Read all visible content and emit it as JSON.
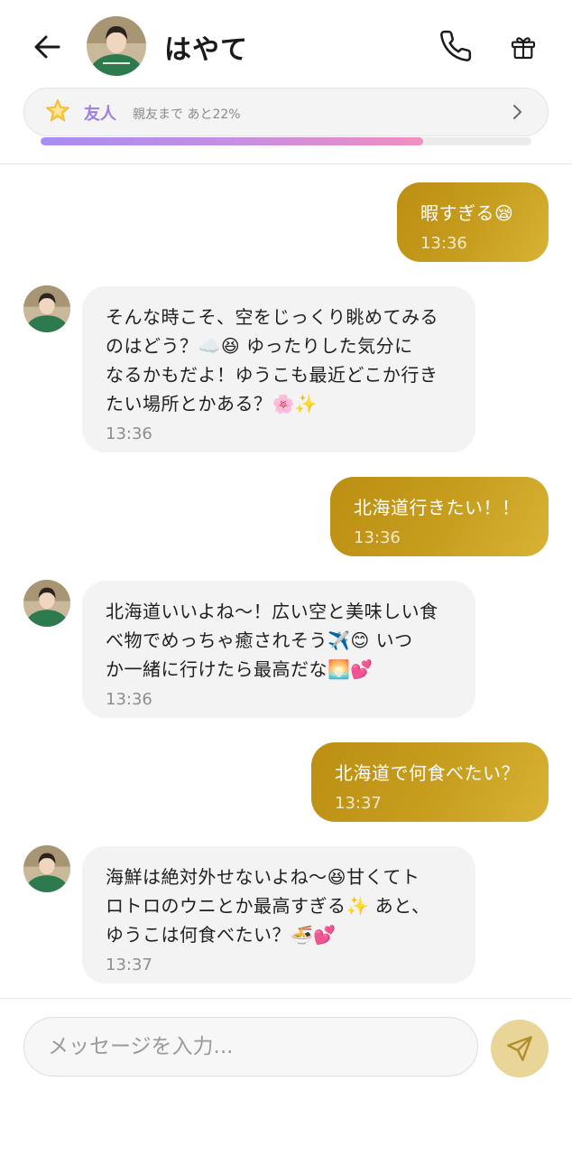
{
  "header": {
    "back_icon": "arrow-left-icon",
    "contact_name": "はやて",
    "call_icon": "phone-icon",
    "gift_icon": "gift-icon"
  },
  "relationship": {
    "icon": "star-icon",
    "level": "友人",
    "progress_text": "親友まで あと22%",
    "progress_fraction": 0.78,
    "chevron_icon": "chevron-right-icon",
    "gradient": [
      "#a88df1",
      "#f08fc0"
    ]
  },
  "messages": [
    {
      "sender": "user",
      "text": "暇すぎる😪",
      "time": "13:36"
    },
    {
      "sender": "contact",
      "text": "そんな時こそ、空をじっくり眺めてみる\nのはどう？☁️😆 ゆったりした気分に\nなるかもだよ！ゆうこも最近どこか行き\nたい場所とかある？🌸✨",
      "time": "13:36"
    },
    {
      "sender": "user",
      "text": "北海道行きたい！！",
      "time": "13:36"
    },
    {
      "sender": "contact",
      "text": "北海道いいよね〜！広い空と美味しい食\nべ物でめっちゃ癒されそう✈️😊 いつ\nか一緒に行けたら最高だな🌅💕",
      "time": "13:36"
    },
    {
      "sender": "user",
      "text": "北海道で何食べたい？",
      "time": "13:37"
    },
    {
      "sender": "contact",
      "text": "海鮮は絶対外せないよね〜😆甘くてト\nロトロのウニとか最高すぎる✨ あと、\nゆうこは何食べたい？🍜💕",
      "time": "13:37"
    }
  ],
  "composer": {
    "placeholder": "メッセージを入力...",
    "value": "",
    "send_icon": "send-icon"
  },
  "colors": {
    "outgoing_bubble": "#c39a1b",
    "incoming_bubble": "#f3f3f3",
    "accent_purple": "#9d7fe0",
    "send_button": "#e8d597"
  }
}
